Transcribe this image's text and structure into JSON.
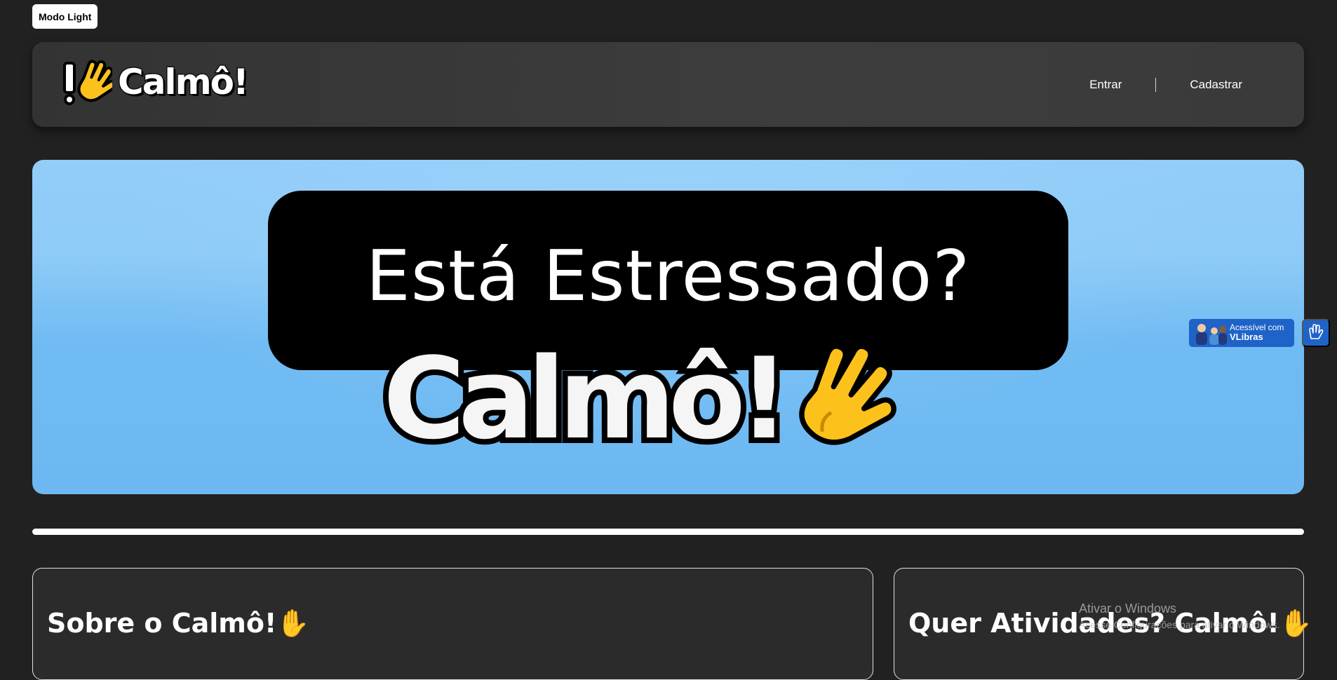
{
  "theme_toggle": {
    "label": "Modo Light"
  },
  "navbar": {
    "logo_text": "Calmô!",
    "links": [
      {
        "label": "Entrar"
      },
      {
        "label": "Cadastrar"
      }
    ]
  },
  "hero": {
    "question": "Está Estressado?",
    "brand": "Calmô!"
  },
  "sections": [
    {
      "title": "Sobre o Calmô!✋"
    },
    {
      "title": "Quer Atividades? Calmô!✋"
    }
  ],
  "vlibras": {
    "line1": "Acessível com",
    "line2": "VLibras"
  },
  "windows_watermark": {
    "line1": "Ativar o Windows",
    "line2": "Acesse Configurações para ativar o Windows."
  },
  "colors": {
    "background": "#212121",
    "navbar": "#3a3a3a",
    "hero_sky": "#7cc2f5",
    "vlibras_blue": "#1f63c9",
    "hand_yellow": "#fcc21b"
  }
}
